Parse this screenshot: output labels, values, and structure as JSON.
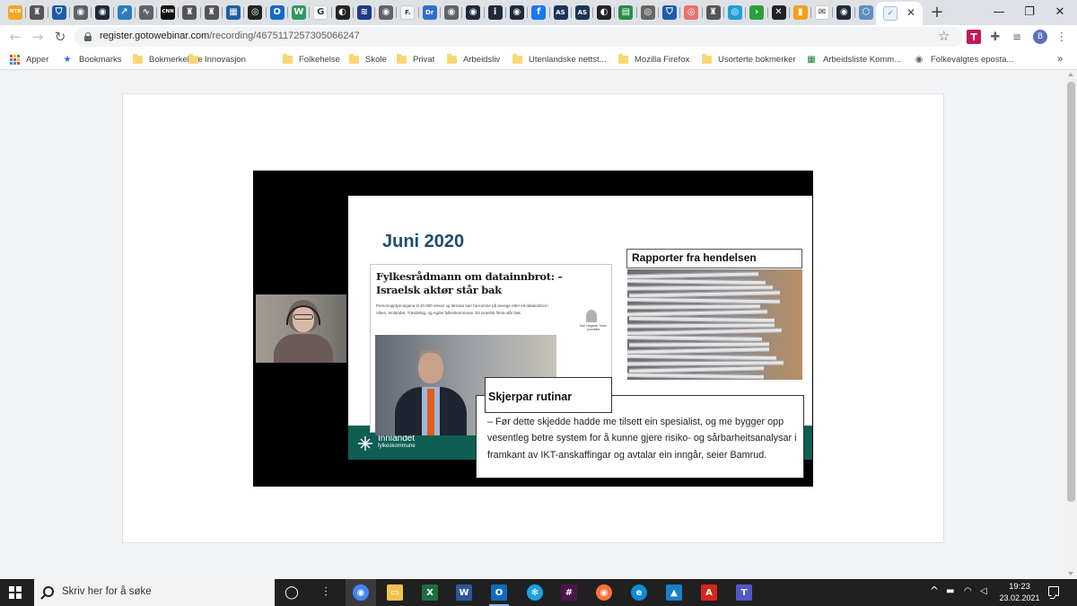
{
  "browser": {
    "tabs": [
      {
        "icon": "ntb-icon",
        "color": "#f5a623",
        "glyph": "NTB"
      },
      {
        "icon": "crest-icon",
        "color": "#555555",
        "glyph": "♜"
      },
      {
        "icon": "shield-icon",
        "color": "#1e5aa8",
        "glyph": "⛉"
      },
      {
        "icon": "globe-icon",
        "color": "#5f6368",
        "glyph": "◉"
      },
      {
        "icon": "nrk-icon",
        "color": "#1e2a3a",
        "glyph": "◉"
      },
      {
        "icon": "arrow-icon",
        "color": "#2b7bbf",
        "glyph": "↗"
      },
      {
        "icon": "chart-icon",
        "color": "#5f6368",
        "glyph": "∿"
      },
      {
        "icon": "cnn-icon",
        "color": "#111111",
        "glyph": "CNN"
      },
      {
        "icon": "crest-icon",
        "color": "#555555",
        "glyph": "♜"
      },
      {
        "icon": "crest-icon",
        "color": "#555555",
        "glyph": "♜"
      },
      {
        "icon": "calendar-icon",
        "color": "#1f5f9f",
        "glyph": "▦"
      },
      {
        "icon": "circle-icon",
        "color": "#222222",
        "glyph": "◎"
      },
      {
        "icon": "outlook-icon",
        "color": "#1669c4",
        "glyph": "O"
      },
      {
        "icon": "w-icon",
        "color": "#2e9a5a",
        "glyph": "W"
      },
      {
        "icon": "google-icon",
        "color": "#ffffff",
        "glyph": "G"
      },
      {
        "icon": "profile-icon",
        "color": "#222222",
        "glyph": "◐"
      },
      {
        "icon": "ribbon-icon",
        "color": "#1e3a8a",
        "glyph": "≋"
      },
      {
        "icon": "globe-icon",
        "color": "#5f6368",
        "glyph": "◉"
      },
      {
        "icon": "f-icon",
        "color": "#f1f3f4",
        "glyph": "F."
      },
      {
        "icon": "dr-icon",
        "color": "#2d6fcf",
        "glyph": "Dr"
      },
      {
        "icon": "globe-icon",
        "color": "#5f6368",
        "glyph": "◉"
      },
      {
        "icon": "nrk-icon",
        "color": "#1e2a3a",
        "glyph": "◉"
      },
      {
        "icon": "info-icon",
        "color": "#1e2a3a",
        "glyph": "i"
      },
      {
        "icon": "nrk-icon",
        "color": "#1e2a3a",
        "glyph": "◉"
      },
      {
        "icon": "facebook-icon",
        "color": "#1877f2",
        "glyph": "f"
      },
      {
        "icon": "as-icon",
        "color": "#1d3556",
        "glyph": "AS"
      },
      {
        "icon": "as-icon",
        "color": "#1d3556",
        "glyph": "AS"
      },
      {
        "icon": "profile-icon",
        "color": "#222222",
        "glyph": "◐"
      },
      {
        "icon": "sheet-icon",
        "color": "#2a8a4a",
        "glyph": "▤"
      },
      {
        "icon": "ring-icon",
        "color": "#666666",
        "glyph": "◎"
      },
      {
        "icon": "shield-icon",
        "color": "#1e5aa8",
        "glyph": "⛉"
      },
      {
        "icon": "target-icon",
        "color": "#e8726b",
        "glyph": "◎"
      },
      {
        "icon": "crest-icon",
        "color": "#555555",
        "glyph": "♜"
      },
      {
        "icon": "ring-icon",
        "color": "#1f9fd6",
        "glyph": "◎"
      },
      {
        "icon": "play-icon",
        "color": "#2c9f3d",
        "glyph": "›"
      },
      {
        "icon": "x-icon",
        "color": "#222222",
        "glyph": "✕"
      },
      {
        "icon": "bars-icon",
        "color": "#f6a01a",
        "glyph": "▮"
      },
      {
        "icon": "mail-icon",
        "color": "#ffffff",
        "glyph": "✉"
      },
      {
        "icon": "nrk-icon",
        "color": "#1e2a3a",
        "glyph": "◉"
      },
      {
        "icon": "hexagon-icon",
        "color": "#5f8fbf",
        "glyph": "⬡"
      }
    ],
    "active_tab_icon": "gotowebinar-icon",
    "url_domain": "register.gotowebinar.com",
    "url_path": "/recording/4675117257305066247",
    "profile_initial": "B",
    "bookmarks": [
      {
        "label": "Apper",
        "type": "apps"
      },
      {
        "label": "Bookmarks",
        "type": "star"
      },
      {
        "label": "Bokmerkelinje",
        "type": "folder"
      },
      {
        "label": "Innovasjon",
        "type": "folder"
      },
      {
        "label": "Folkehelse",
        "type": "folder"
      },
      {
        "label": "Skole",
        "type": "folder"
      },
      {
        "label": "Privat",
        "type": "folder"
      },
      {
        "label": "Arbeidsliv",
        "type": "folder"
      },
      {
        "label": "Utenlandske nettst...",
        "type": "folder"
      },
      {
        "label": "Mozilla Firefox",
        "type": "folder"
      },
      {
        "label": "Usorterte bokmerker",
        "type": "folder"
      },
      {
        "label": "Arbeidsliste Komm...",
        "type": "sheet"
      },
      {
        "label": "Folkevalgtes eposta...",
        "type": "globe"
      }
    ],
    "bookmarks_overflow": "»"
  },
  "slide": {
    "title": "Juni 2020",
    "article_headline": "Fylkesrådmann om datainnbrot: – Israelsk aktør står bak",
    "article_lead": "Personopplysningane til 40.000 elevar og lærarar kan ha komne på avvege etter eit datainnbrot i Viken, Innlandet, Trøndelag, og Agder fylkeskommune. Eit israelsk firma står bak.",
    "author_name": "Kari Høgseth Torbe journalist",
    "reports_title": "Rapporter fra hendelsen",
    "quote_title": "Skjerpar rutinar",
    "quote_text": "– Før dette skjedde hadde me tilsett ein spesialist, og me bygger opp vesentleg betre system for å kunne gjere risiko- og sårbarheitsanalysar i framkant av IKT-anskaffingar og avtalar ein inngår, seier Bamrud.",
    "logo_name": "Innlandet",
    "logo_sub": "fylkeskommune",
    "accent_color": "#0f5e54",
    "title_color": "#1d4f6b"
  },
  "taskbar": {
    "search_placeholder": "Skriv her for å søke",
    "apps": [
      {
        "icon": "task-view-icon",
        "color": "#202020",
        "glyph": "◯",
        "state": ""
      },
      {
        "icon": "widgets-icon",
        "color": "#202020",
        "glyph": "⫶",
        "state": ""
      },
      {
        "icon": "chrome-icon",
        "color": "#4285f4",
        "glyph": "◉",
        "state": "active"
      },
      {
        "icon": "file-explorer-icon",
        "color": "#f2c14e",
        "glyph": "▭",
        "state": ""
      },
      {
        "icon": "excel-icon",
        "color": "#1d6f42",
        "glyph": "X",
        "state": ""
      },
      {
        "icon": "word-icon",
        "color": "#2b579a",
        "glyph": "W",
        "state": ""
      },
      {
        "icon": "outlook-icon",
        "color": "#0f6cbd",
        "glyph": "O",
        "state": "running"
      },
      {
        "icon": "network-icon",
        "color": "#1ca1e2",
        "glyph": "✻",
        "state": ""
      },
      {
        "icon": "slack-icon",
        "color": "#4a154b",
        "glyph": "#",
        "state": ""
      },
      {
        "icon": "firefox-icon",
        "color": "#ff7139",
        "glyph": "◉",
        "state": ""
      },
      {
        "icon": "edge-icon",
        "color": "#0c8bd6",
        "glyph": "e",
        "state": ""
      },
      {
        "icon": "photos-icon",
        "color": "#1a7fc9",
        "glyph": "▲",
        "state": ""
      },
      {
        "icon": "acrobat-icon",
        "color": "#d7261e",
        "glyph": "A",
        "state": ""
      },
      {
        "icon": "teams-icon",
        "color": "#5059c9",
        "glyph": "T",
        "state": ""
      }
    ],
    "tray_chevron": "^",
    "time": "19:23",
    "date": "23.02.2021"
  }
}
